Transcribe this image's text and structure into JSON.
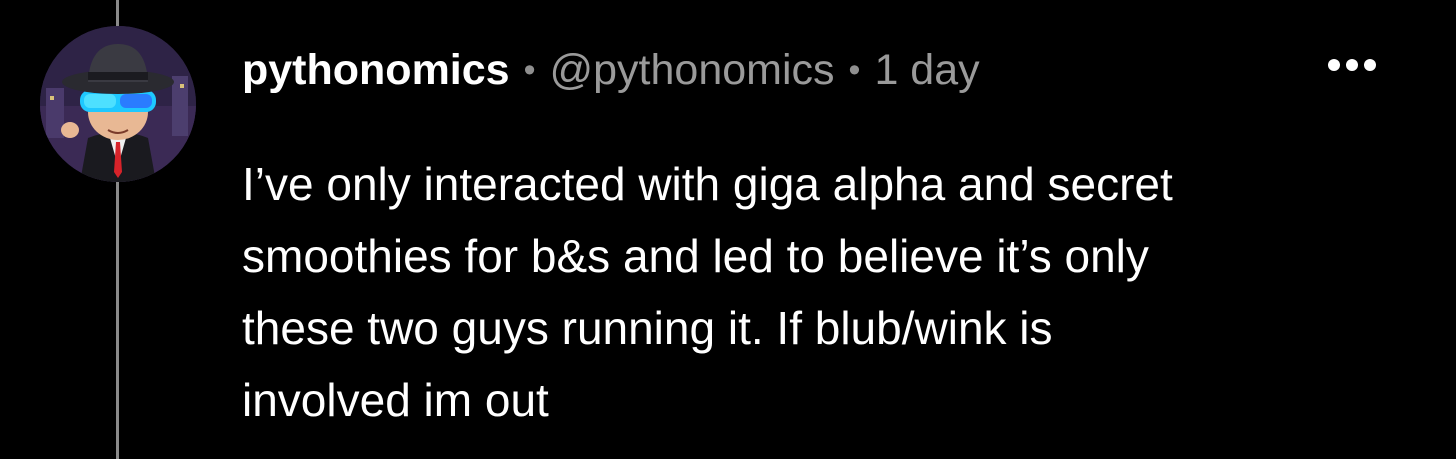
{
  "post": {
    "username": "pythonomics",
    "handle": "@pythonomics",
    "timestamp": "1 day",
    "separator": "•",
    "more_icon": "more-horizontal-icon",
    "body_lines": [
      "I’ve only interacted with giga alpha and secret",
      "smoothies for b&s and led to believe it’s only",
      "these two guys running it. If blub/wink is",
      "involved im out"
    ]
  },
  "colors": {
    "background": "#000000",
    "text": "#ffffff",
    "muted": "#9a9a9a",
    "thread_line": "#8a8a8a"
  }
}
